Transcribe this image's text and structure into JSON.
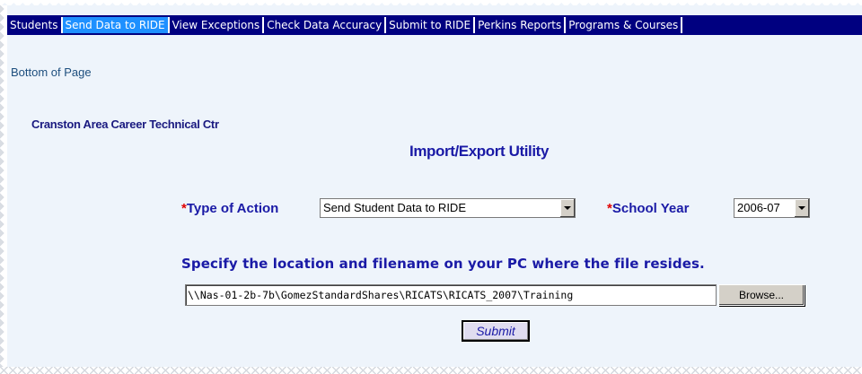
{
  "nav": {
    "items": [
      {
        "label": "Students",
        "active": false
      },
      {
        "label": "Send Data to RIDE",
        "active": true
      },
      {
        "label": "View Exceptions",
        "active": false
      },
      {
        "label": "Check Data Accuracy",
        "active": false
      },
      {
        "label": "Submit to RIDE",
        "active": false
      },
      {
        "label": "Perkins Reports",
        "active": false
      },
      {
        "label": "Programs & Courses",
        "active": false
      }
    ]
  },
  "links": {
    "bottom_of_page": "Bottom of Page"
  },
  "header": {
    "organization": "Cranston Area Career Technical Ctr",
    "title": "Import/Export Utility"
  },
  "form": {
    "required_marker": "*",
    "type_of_action_label": "Type of Action",
    "type_of_action_value": "Send Student Data to RIDE",
    "school_year_label": "School Year",
    "school_year_value": "2006-07",
    "file_prompt": "Specify the location and filename on your PC where the file resides.",
    "file_path_value": "\\\\Nas-01-2b-7b\\GomezStandardShares\\RICATS\\RICATS_2007\\Training",
    "browse_label": "Browse...",
    "submit_label": "Submit"
  },
  "colors": {
    "nav_bg": "#000080",
    "nav_active": "#1e90ff",
    "label_blue": "#1a1aa6",
    "required_red": "#e00000",
    "page_bg": "#eef4fb"
  }
}
